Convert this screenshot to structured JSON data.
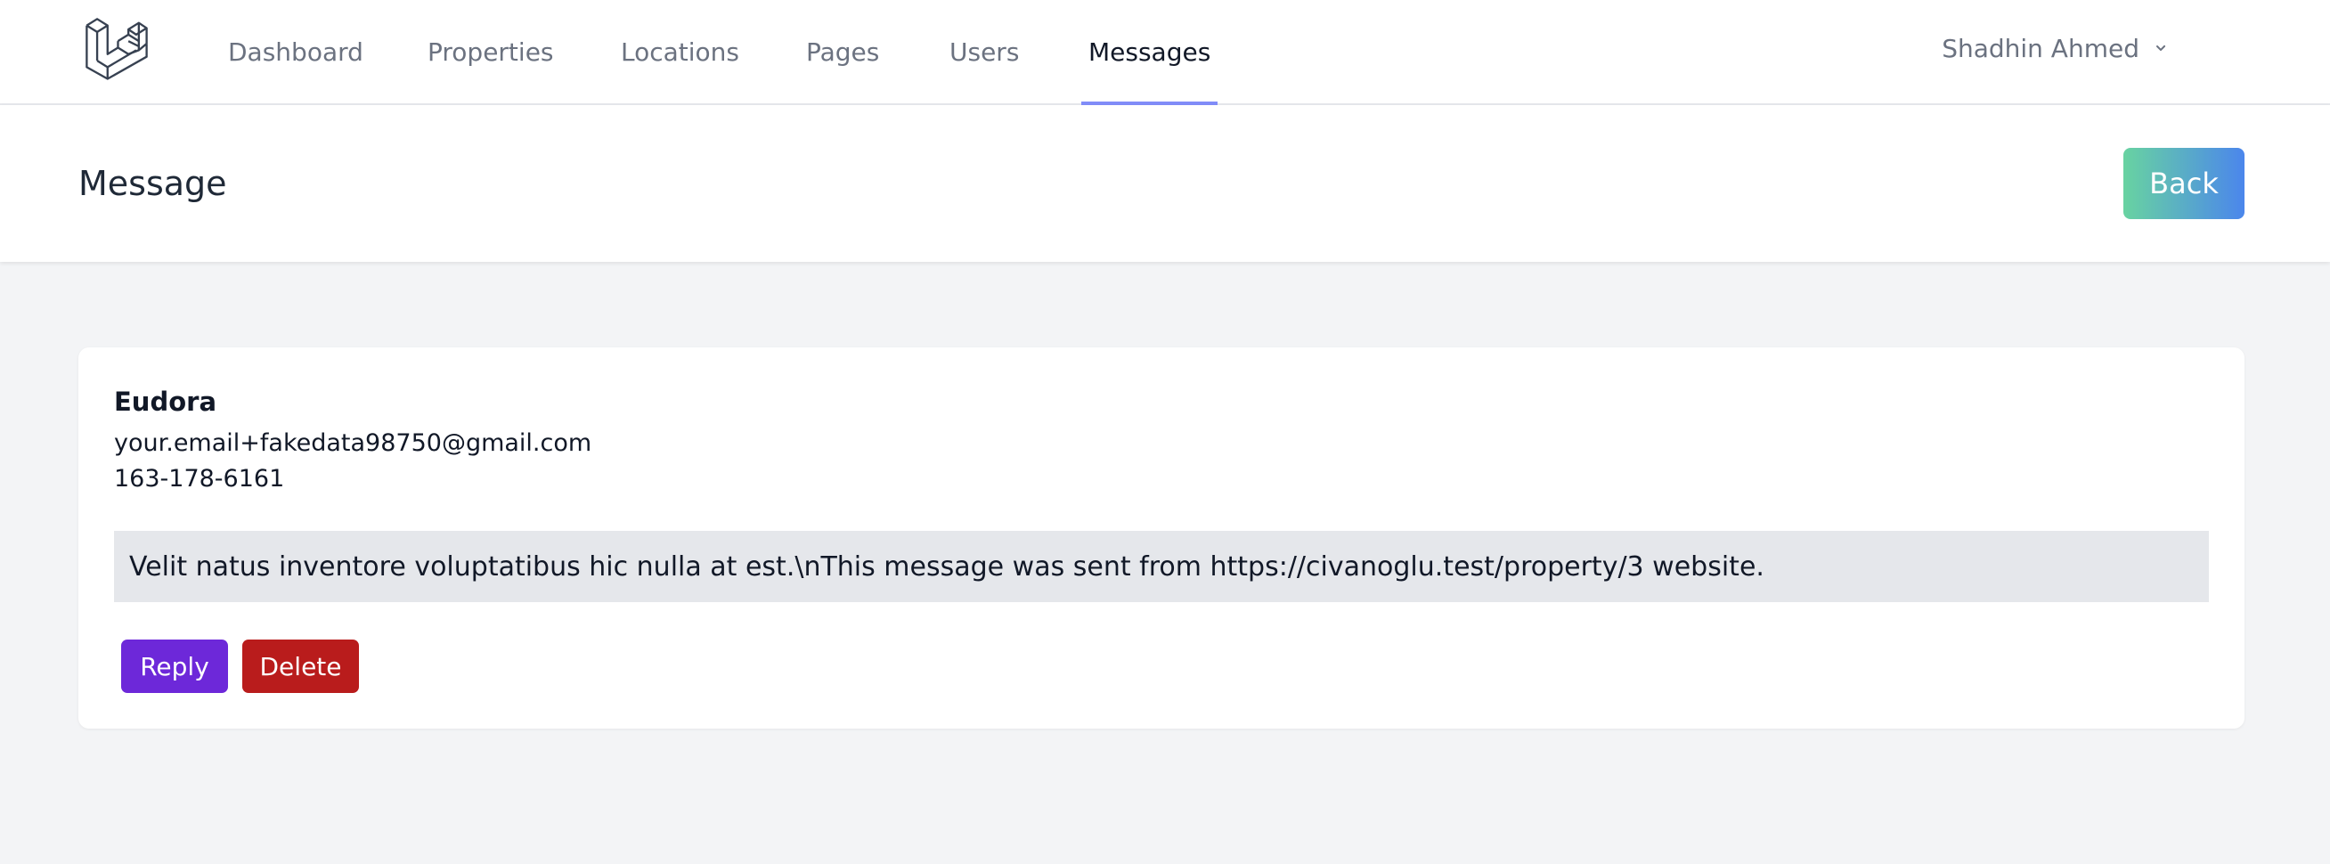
{
  "nav": {
    "items": [
      {
        "label": "Dashboard"
      },
      {
        "label": "Properties"
      },
      {
        "label": "Locations"
      },
      {
        "label": "Pages"
      },
      {
        "label": "Users"
      },
      {
        "label": "Messages",
        "active": true
      }
    ],
    "user_name": "Shadhin Ahmed",
    "active_indicator_color": "#818cf8"
  },
  "header": {
    "title": "Message",
    "back_label": "Back"
  },
  "message": {
    "name": "Eudora",
    "email": "your.email+fakedata98750@gmail.com",
    "phone": "163-178-6161",
    "body": "Velit natus inventore voluptatibus hic nulla at est.\\nThis message was sent from https://civanoglu.test/property/3 website.",
    "reply_label": "Reply",
    "delete_label": "Delete"
  },
  "colors": {
    "reply": "#6d28d9",
    "delete": "#b91c1c",
    "back_gradient_start": "#68d3a1",
    "back_gradient_end": "#4b86ec"
  },
  "icons": {
    "logo": "laravel-logo-icon",
    "user_menu": "chevron-down-icon"
  }
}
